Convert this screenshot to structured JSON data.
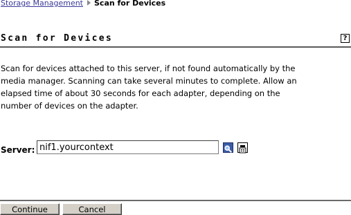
{
  "breadcrumb": {
    "parent": "Storage Management",
    "current": "Scan for Devices"
  },
  "page": {
    "title": "Scan for Devices",
    "help_icon": "?",
    "description": "Scan for devices attached to this server, if not found automatically by the media manager. Scanning can take several minutes to complete. Allow an elapsed time of about 30 seconds for each adapter, depending on the number of devices on the adapter."
  },
  "server": {
    "label": "Server:",
    "value": "nif1.yourcontext",
    "search_icon": "magnifier-icon",
    "browse_icon": "object-browser-icon"
  },
  "buttons": {
    "continue": "Continue",
    "cancel": "Cancel"
  },
  "colors": {
    "link": "#3a3a99",
    "rule": "#5a5a5a",
    "button_face": "#d4d0c8",
    "search_icon_bg": "#3b5da6"
  }
}
